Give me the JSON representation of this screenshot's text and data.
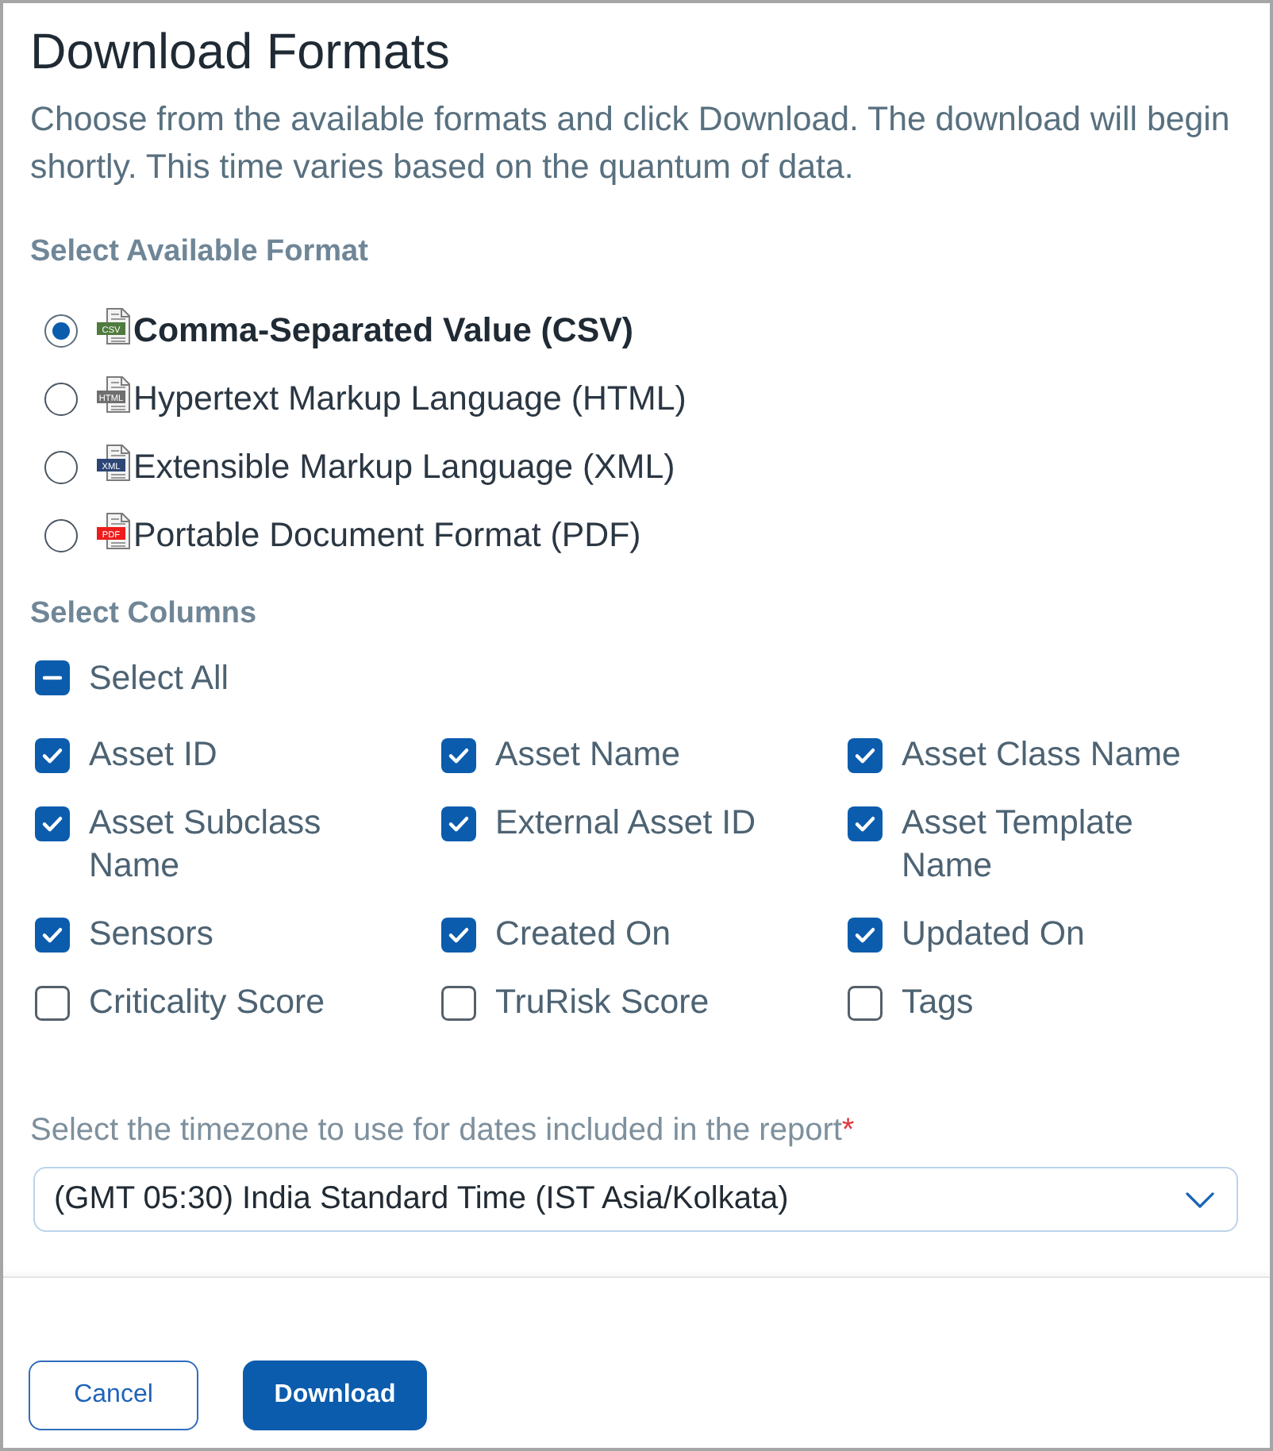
{
  "dialog": {
    "title": "Download Formats",
    "description": "Choose from the available formats and click Download. The download will begin shortly. This time varies based on the quantum of data."
  },
  "format_section": {
    "heading": "Select Available Format",
    "formats": [
      {
        "kind": "csv",
        "icon_label": "CSV",
        "label": "Comma-Separated Value (CSV)",
        "selected": true
      },
      {
        "kind": "html",
        "icon_label": "HTML",
        "label": "Hypertext Markup Language (HTML)",
        "selected": false
      },
      {
        "kind": "xml",
        "icon_label": "XML",
        "label": "Extensible Markup Language (XML)",
        "selected": false
      },
      {
        "kind": "pdf",
        "icon_label": "PDF",
        "label": "Portable Document Format (PDF)",
        "selected": false
      }
    ]
  },
  "columns_section": {
    "heading": "Select Columns",
    "select_all": {
      "label": "Select All",
      "checked": true,
      "indeterminate": true
    },
    "columns": [
      {
        "label": "Asset ID",
        "checked": true
      },
      {
        "label": "Asset Name",
        "checked": true
      },
      {
        "label": "Asset Class Name",
        "checked": true
      },
      {
        "label": "Asset Subclass Name",
        "checked": true
      },
      {
        "label": "External Asset ID",
        "checked": true
      },
      {
        "label": "Asset Template Name",
        "checked": true
      },
      {
        "label": "Sensors",
        "checked": true
      },
      {
        "label": "Created On",
        "checked": true
      },
      {
        "label": "Updated On",
        "checked": true
      },
      {
        "label": "Criticality Score",
        "checked": false
      },
      {
        "label": "TruRisk Score",
        "checked": false
      },
      {
        "label": "Tags",
        "checked": false
      }
    ]
  },
  "timezone": {
    "label": "Select the timezone to use for dates included in the report",
    "required_mark": "*",
    "value": "(GMT 05:30) India Standard Time (IST Asia/Kolkata)"
  },
  "buttons": [
    {
      "label": "Cancel",
      "kind": "secondary"
    },
    {
      "label": "Download",
      "kind": "primary"
    }
  ]
}
